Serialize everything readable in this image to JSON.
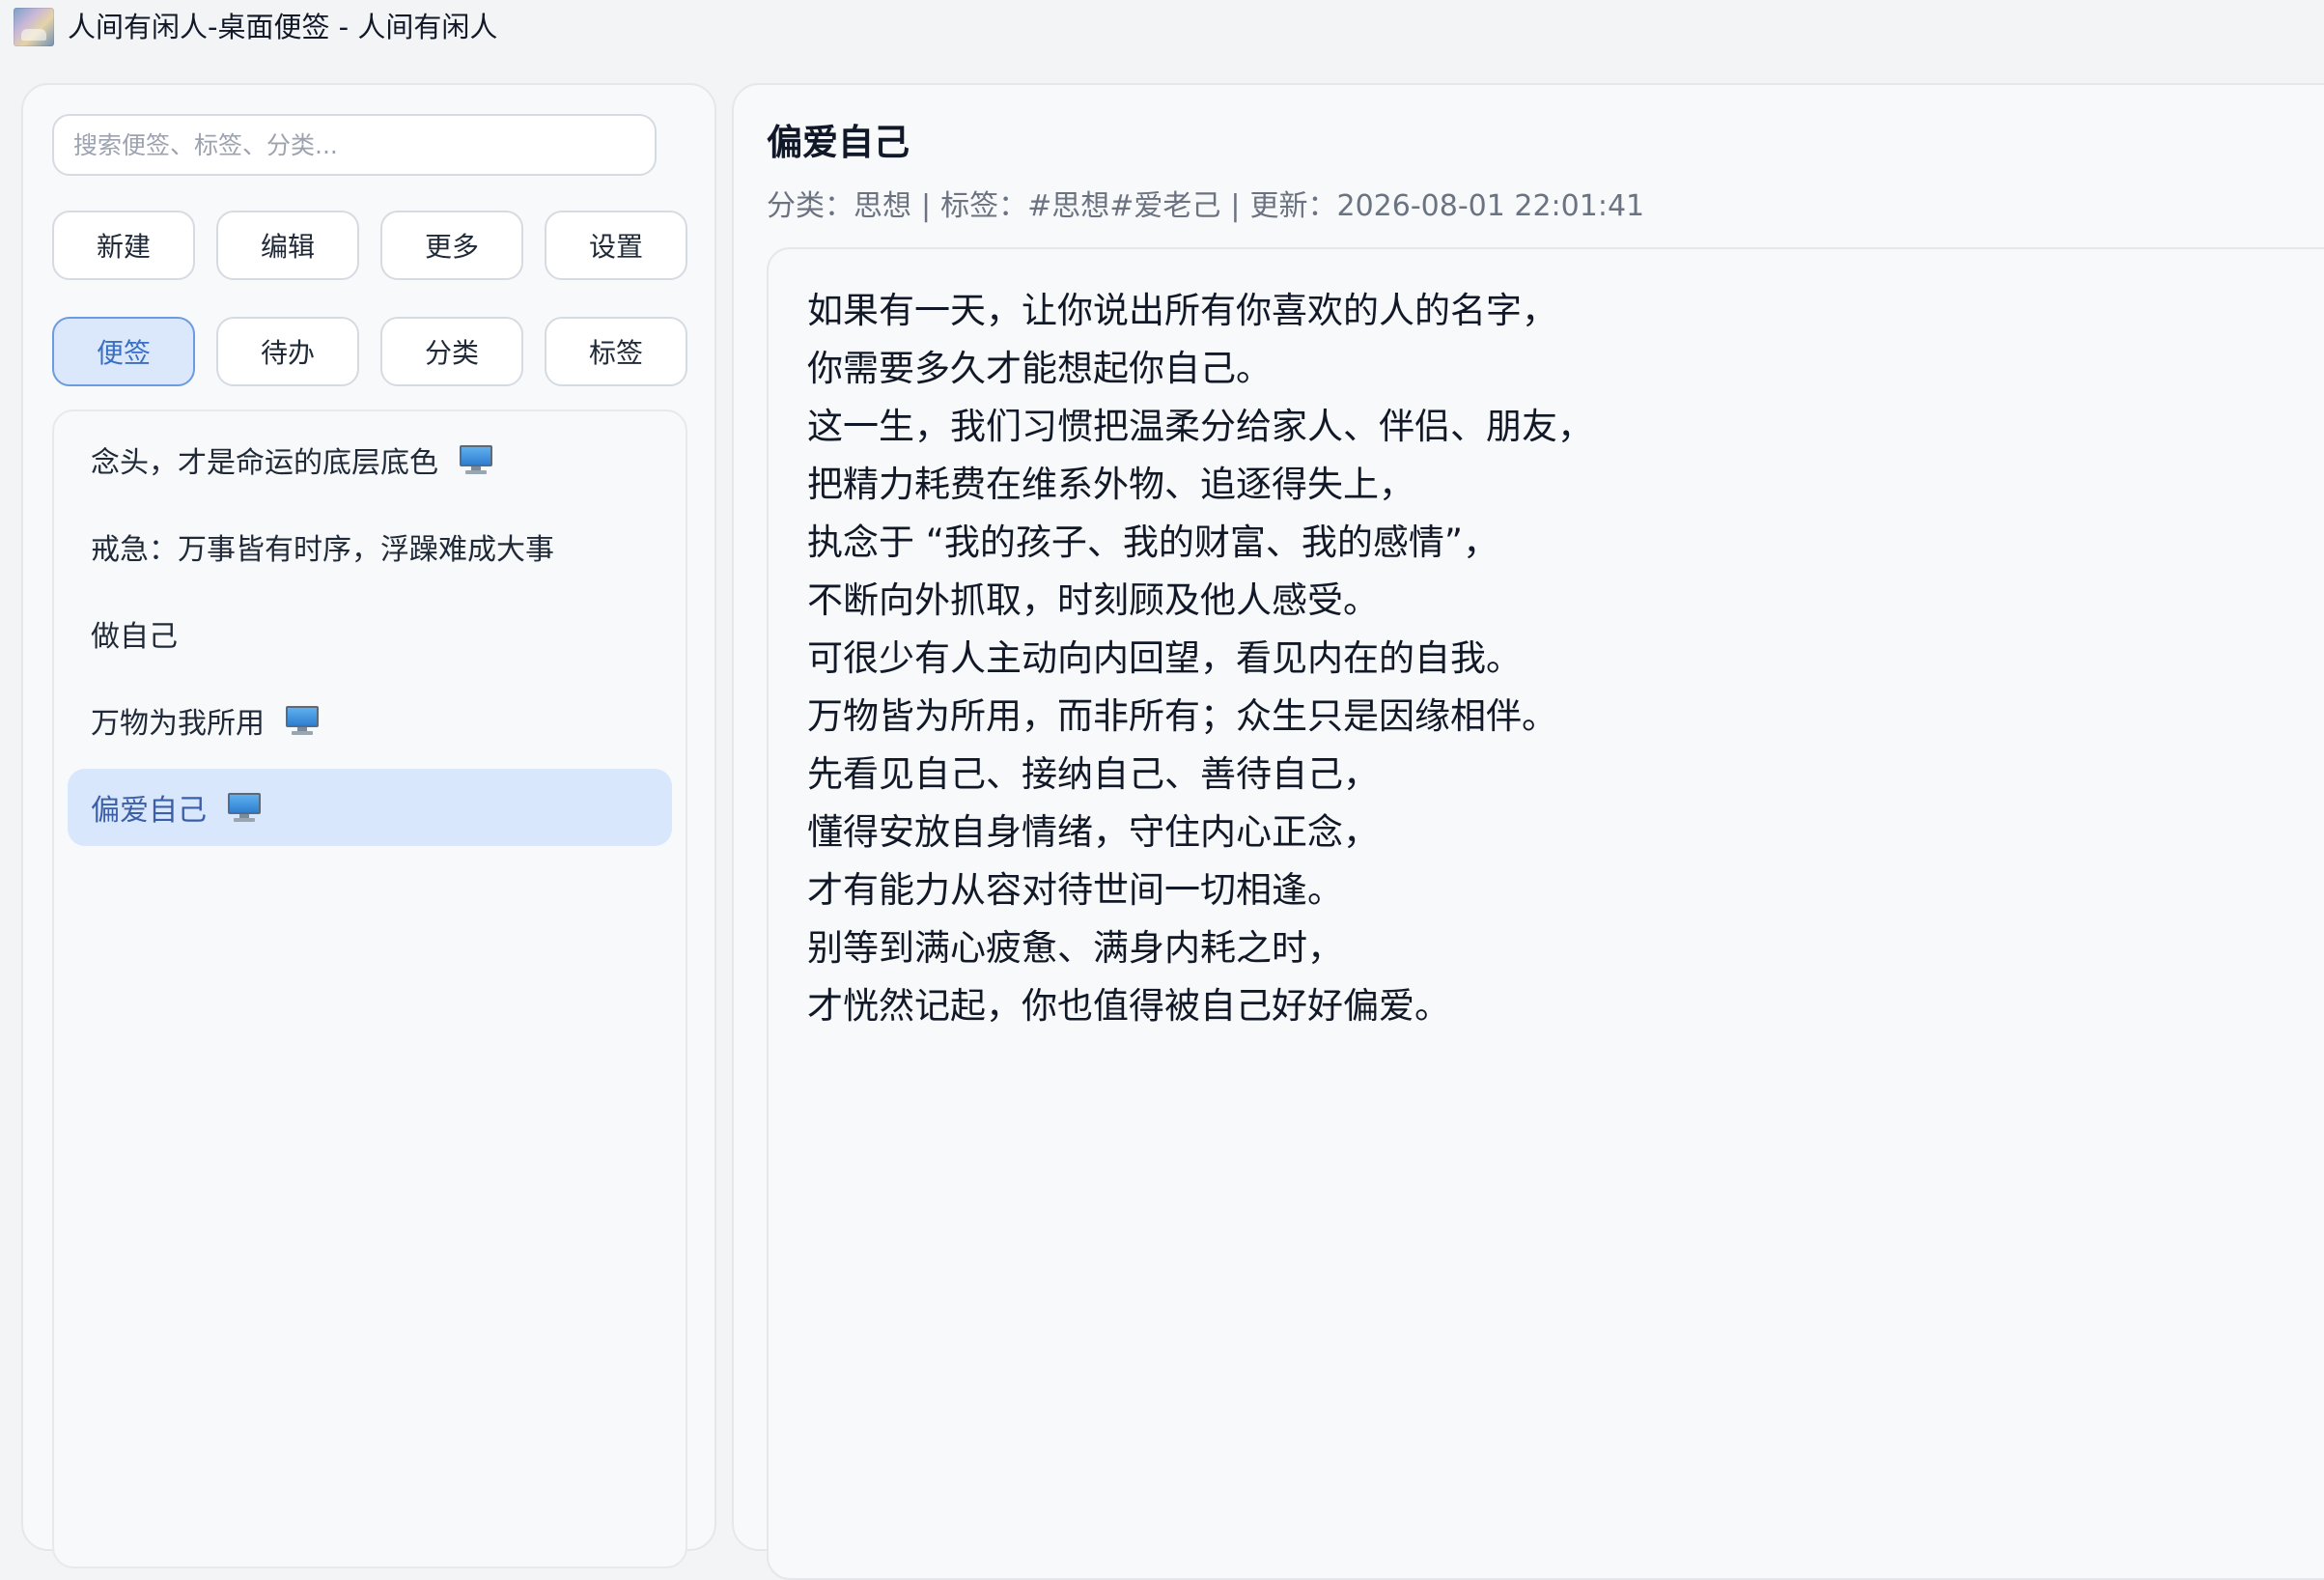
{
  "window": {
    "title": "人间有闲人-桌面便签 - 人间有闲人"
  },
  "search": {
    "placeholder": "搜索便签、标签、分类..."
  },
  "toolbar": {
    "new_label": "新建",
    "edit_label": "编辑",
    "more_label": "更多",
    "settings_label": "设置"
  },
  "views": {
    "notes_label": "便签",
    "todo_label": "待办",
    "category_label": "分类",
    "tags_label": "标签",
    "active": "便签"
  },
  "notes": [
    {
      "title": "念头，才是命运的底层底色",
      "pinned_desktop": true,
      "selected": false
    },
    {
      "title": "戒急：万事皆有时序，浮躁难成大事",
      "pinned_desktop": false,
      "selected": false
    },
    {
      "title": "做自己",
      "pinned_desktop": false,
      "selected": false
    },
    {
      "title": "万物为我所用",
      "pinned_desktop": true,
      "selected": false
    },
    {
      "title": "偏爱自己",
      "pinned_desktop": true,
      "selected": true
    }
  ],
  "detail": {
    "title": "偏爱自己",
    "category_label": "分类：",
    "category": "思想",
    "tags_label": "标签：",
    "tags": "#思想#爱老己",
    "updated_label": "更新：",
    "updated": "2026-08-01 22:01:41",
    "separator": "|",
    "lines": [
      "如果有一天，让你说出所有你喜欢的人的名字，",
      "你需要多久才能想起你自己。",
      "这一生，我们习惯把温柔分给家人、伴侣、朋友，",
      "把精力耗费在维系外物、追逐得失上，",
      "执念于 “我的孩子、我的财富、我的感情”，",
      "不断向外抓取，时刻顾及他人感受。",
      "可很少有人主动向内回望，看见内在的自我。",
      "万物皆为所用，而非所有；众生只是因缘相伴。",
      "先看见自己、接纳自己、善待自己，",
      "懂得安放自身情绪，守住内心正念，",
      "才有能力从容对待世间一切相逢。",
      "别等到满心疲惫、满身内耗之时，",
      "才恍然记起，你也值得被自己好好偏爱。"
    ]
  },
  "icons": {
    "app": "app-landscape-icon",
    "desktop_pin": "desktop-monitor-icon"
  },
  "colors": {
    "accent": "#3b6fc2",
    "selected_bg": "#d9e7fc",
    "active_button_bg": "#dbe8fb",
    "meta_text": "#6b7280"
  }
}
